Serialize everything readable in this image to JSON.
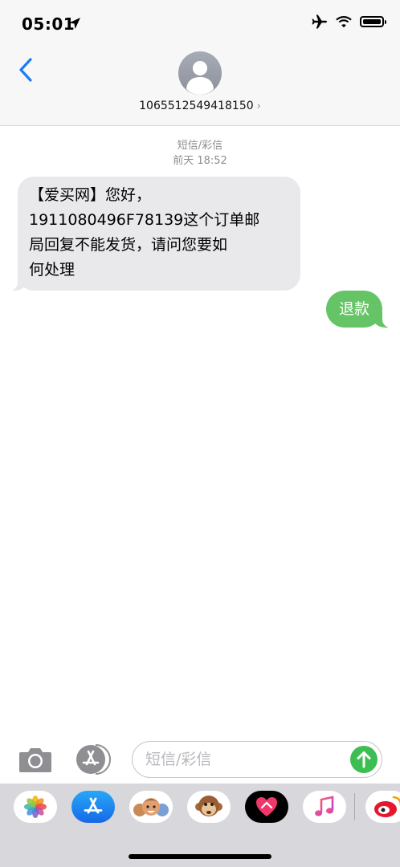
{
  "status_bar": {
    "time": "05:01",
    "icons": [
      "location-arrow-icon",
      "airplane-icon",
      "wifi-icon",
      "battery-icon"
    ]
  },
  "header": {
    "back_icon": "chevron-left-icon",
    "avatar_icon": "person-silhouette-icon",
    "contact_number": "1065512549418150",
    "contact_chevron": "›"
  },
  "conversation": {
    "service_label": "短信/彩信",
    "timestamp": "前天 18:52",
    "messages": [
      {
        "direction": "incoming",
        "lines": [
          "【爱买网】您好，",
          "1911080496F78139这个订单邮",
          "局回复不能发货，请问您要如",
          "何处理"
        ]
      },
      {
        "direction": "outgoing",
        "text": "退款"
      }
    ]
  },
  "composer": {
    "placeholder": "短信/彩信",
    "camera_icon": "camera-icon",
    "apps_icon": "app-store-icon",
    "send_icon": "send-arrow-icon"
  },
  "app_drawer": {
    "apps": [
      "photos-icon",
      "app-store-icon",
      "memoji-icon",
      "animoji-monkey-icon",
      "digital-touch-icon",
      "music-icon",
      "weibo-icon"
    ]
  },
  "colors": {
    "incoming_bubble": "#e9e9eb",
    "outgoing_bubble": "#65c466",
    "accent_blue": "#1a7cf5",
    "send_green": "#3dbe52"
  }
}
